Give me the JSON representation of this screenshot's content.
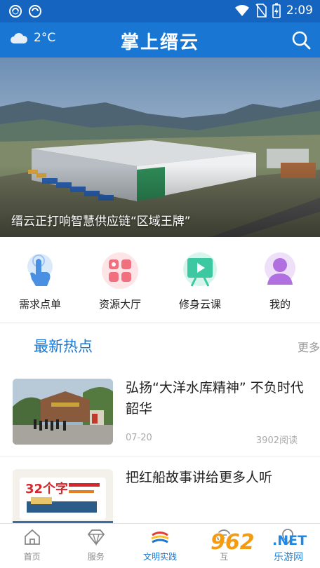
{
  "status_bar": {
    "time": "2:09"
  },
  "header": {
    "weather_temp": "2°C",
    "title": "掌上缙云"
  },
  "banner": {
    "caption": "缙云正打响智慧供应链“区域王牌”"
  },
  "services": [
    {
      "label": "需求点单",
      "icon": "touch-hand-icon",
      "color": "#5aa0e8"
    },
    {
      "label": "资源大厅",
      "icon": "grid-apps-icon",
      "color": "#f07080"
    },
    {
      "label": "修身云课",
      "icon": "video-play-board-icon",
      "color": "#3cc8a0"
    },
    {
      "label": "我的",
      "icon": "user-profile-icon",
      "color": "#b070e0"
    }
  ],
  "hot_section": {
    "title": "最新热点",
    "more": "更多"
  },
  "news": [
    {
      "title": "弘扬“大洋水库精神” 不负时代韶华",
      "date": "07-20",
      "reads": "3902阅读"
    },
    {
      "title": "把红船故事讲给更多人听",
      "thumb_text": "32个字"
    }
  ],
  "bottom_nav": [
    {
      "label": "首页",
      "icon": "home-icon"
    },
    {
      "label": "服务",
      "icon": "diamond-icon"
    },
    {
      "label": "文明实践",
      "icon": "civilization-logo-icon",
      "active": true
    },
    {
      "label": "互",
      "icon": "chat-icon"
    },
    {
      "label": "",
      "icon": "location-icon"
    }
  ],
  "watermark": {
    "number": "962",
    "net": ".NET",
    "sub": "乐游网"
  },
  "colors": {
    "primary": "#1976d2",
    "statusbar": "#1565c0"
  }
}
